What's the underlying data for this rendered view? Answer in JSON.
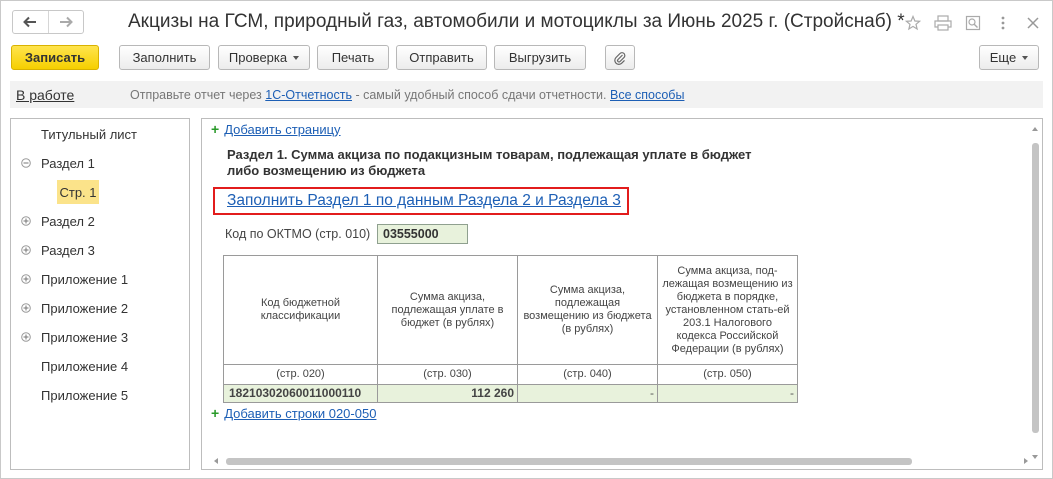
{
  "window": {
    "title": "Акцизы на ГСМ, природный газ, автомобили и мотоциклы за Июнь 2025 г. (Стройснаб) *",
    "icons": [
      "back-icon",
      "forward-icon",
      "favorite-star-icon",
      "print-icon",
      "preview-icon",
      "more-icon",
      "close-icon"
    ]
  },
  "toolbar": {
    "save_label": "Записать",
    "fill_label": "Заполнить",
    "check_label": "Проверка",
    "print_label": "Печать",
    "send_label": "Отправить",
    "export_label": "Выгрузить",
    "more_label": "Еще",
    "attach_icon": "paperclip-icon"
  },
  "infobar": {
    "status_label": "В работе",
    "text_before": "Отправьте отчет через ",
    "link1": "1С-Отчетность",
    "text_mid": " - самый удобный способ сдачи отчетности. ",
    "link2": "Все способы"
  },
  "tree": {
    "items": [
      {
        "label": "Титульный лист",
        "sign": ""
      },
      {
        "label": "Раздел 1",
        "sign": "minus"
      },
      {
        "label": "Стр. 1",
        "sign": "",
        "selected": true
      },
      {
        "label": "Раздел 2",
        "sign": "plus"
      },
      {
        "label": "Раздел 3",
        "sign": "plus"
      },
      {
        "label": "Приложение 1",
        "sign": "plus"
      },
      {
        "label": "Приложение 2",
        "sign": "plus"
      },
      {
        "label": "Приложение 3",
        "sign": "plus"
      },
      {
        "label": "Приложение 4",
        "sign": ""
      },
      {
        "label": "Приложение 5",
        "sign": ""
      }
    ]
  },
  "main": {
    "add_page": "Добавить страницу",
    "section_title_line1": "Раздел 1. Сумма акциза по подакцизным товарам, подлежащая уплате в бюджет",
    "section_title_line2": "либо возмещению из бюджета",
    "fill_link": "Заполнить Раздел 1 по данным Раздела 2 и Раздела 3",
    "oktmo_label": "Код по ОКТМО  (стр. 010)",
    "oktmo_value": "03555000",
    "table": {
      "headers": [
        "Код бюджетной классификации",
        "Сумма акциза, подлежащая уплате в бюджет (в рублях)",
        "Сумма акциза, подлежащая возмещению из бюджета (в рублях)",
        "Сумма акциза, под-лежащая возмещению из бюджета в порядке, установленном стать-ей 203.1 Налогового кодекса Российской Федерации (в рублях)"
      ],
      "codes": [
        "(стр. 020)",
        "(стр. 030)",
        "(стр. 040)",
        "(стр. 050)"
      ],
      "row": [
        "18210302060011000110",
        "112 260",
        "-",
        "-"
      ]
    },
    "add_rows": "Добавить строки 020-050"
  }
}
